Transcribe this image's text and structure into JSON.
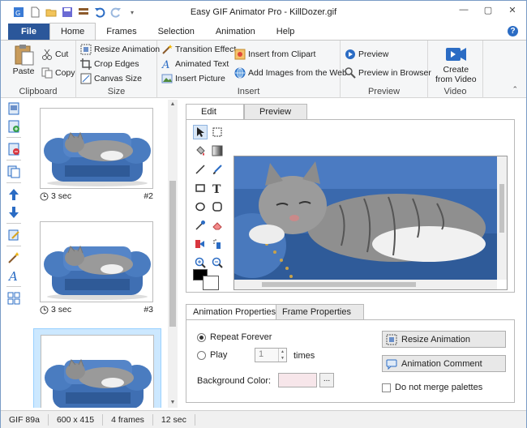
{
  "window": {
    "title": "Easy GIF Animator Pro - KillDozer.gif"
  },
  "tabs": [
    "File",
    "Home",
    "Frames",
    "Selection",
    "Animation",
    "Help"
  ],
  "ribbon": {
    "clipboard": {
      "label": "Clipboard",
      "paste": "Paste",
      "cut": "Cut",
      "copy": "Copy"
    },
    "size": {
      "label": "Size",
      "resize": "Resize Animation",
      "crop": "Crop Edges",
      "canvas": "Canvas Size"
    },
    "insert": {
      "label": "Insert",
      "transition": "Transition Effect",
      "animated_text": "Animated Text",
      "insert_picture": "Insert Picture",
      "clipart": "Insert from Clipart",
      "web": "Add Images from the Web"
    },
    "preview": {
      "label": "Preview",
      "preview": "Preview",
      "browser": "Preview in Browser"
    },
    "video": {
      "label": "Video",
      "create_line1": "Create",
      "create_line2": "from Video"
    }
  },
  "frames": [
    {
      "duration": "3 sec",
      "number": "#2"
    },
    {
      "duration": "3 sec",
      "number": "#3"
    },
    {
      "duration": "",
      "number": ""
    }
  ],
  "edit_tabs": [
    "Edit",
    "Preview"
  ],
  "prop_tabs": [
    "Animation Properties",
    "Frame Properties"
  ],
  "properties": {
    "repeat_forever": "Repeat Forever",
    "play": "Play",
    "play_count": "1",
    "times": "times",
    "background_color": "Background Color:",
    "dots": "...",
    "resize_animation": "Resize Animation",
    "animation_comment": "Animation Comment",
    "no_merge": "Do not merge palettes"
  },
  "status": {
    "format": "GIF 89a",
    "dimensions": "600 x 415",
    "frames": "4 frames",
    "duration": "12 sec"
  },
  "colors": {
    "accent": "#2b579a",
    "selection": "#cce8ff",
    "sofa": "#3f6fb3"
  }
}
